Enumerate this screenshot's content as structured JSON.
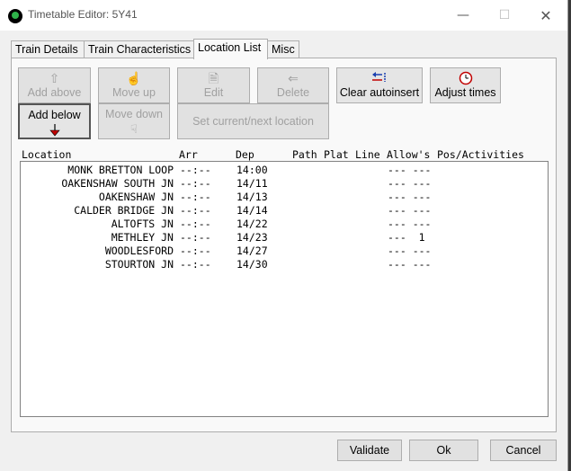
{
  "window": {
    "title": "Timetable Editor: 5Y41",
    "minimize_glyph": "—",
    "maximize_glyph": "☐",
    "close_glyph": "✕"
  },
  "tabs": [
    {
      "label": "Train Details",
      "accel": "D"
    },
    {
      "label": "Train Characteristics",
      "accel": "a"
    },
    {
      "label": "Location List",
      "accel": ""
    },
    {
      "label": "Misc",
      "accel": ""
    }
  ],
  "toolbar": {
    "add_above": "Add above",
    "move_up": "Move up",
    "edit": "Edit",
    "delete": "Delete",
    "clear_autoinsert": "Clear autoinsert",
    "adjust_times": "Adjust times",
    "add_below": "Add below",
    "move_down": "Move down",
    "set_current_next": "Set current/next location"
  },
  "icons": {
    "add_above": "up-arrow-icon",
    "move_up": "hand-up-icon",
    "edit": "edit-document-icon",
    "delete": "delete-icon",
    "clear_autoinsert": "clear-autoinsert-icon",
    "adjust_times": "clock-icon",
    "add_below": "down-arrow-icon",
    "move_down": "hand-down-icon"
  },
  "columns": [
    "Location",
    "Arr",
    "Dep",
    "Path",
    "Plat",
    "Line",
    "Allow's",
    "Pos/Activities"
  ],
  "rows": [
    {
      "location": "MONK BRETTON LOOP",
      "arr": "--:--",
      "dep": "14:00",
      "allow": "--- ---"
    },
    {
      "location": "OAKENSHAW SOUTH JN",
      "arr": "--:--",
      "dep": "14/11",
      "allow": "--- ---"
    },
    {
      "location": "OAKENSHAW JN",
      "arr": "--:--",
      "dep": "14/13",
      "allow": "--- ---"
    },
    {
      "location": "CALDER BRIDGE JN",
      "arr": "--:--",
      "dep": "14/14",
      "allow": "--- ---"
    },
    {
      "location": "ALTOFTS JN",
      "arr": "--:--",
      "dep": "14/22",
      "allow": "--- ---"
    },
    {
      "location": "METHLEY JN",
      "arr": "--:--",
      "dep": "14/23",
      "allow": "---  1"
    },
    {
      "location": "WOODLESFORD",
      "arr": "--:--",
      "dep": "14/27",
      "allow": "--- ---"
    },
    {
      "location": "STOURTON JN",
      "arr": "--:--",
      "dep": "14/30",
      "allow": "--- ---"
    }
  ],
  "footer": {
    "validate": "Validate",
    "ok": "Ok",
    "cancel": "Cancel"
  },
  "colors": {
    "arrow_red": "#c00000",
    "arrow_blue": "#1a3fb0",
    "clock_red": "#c00000"
  }
}
